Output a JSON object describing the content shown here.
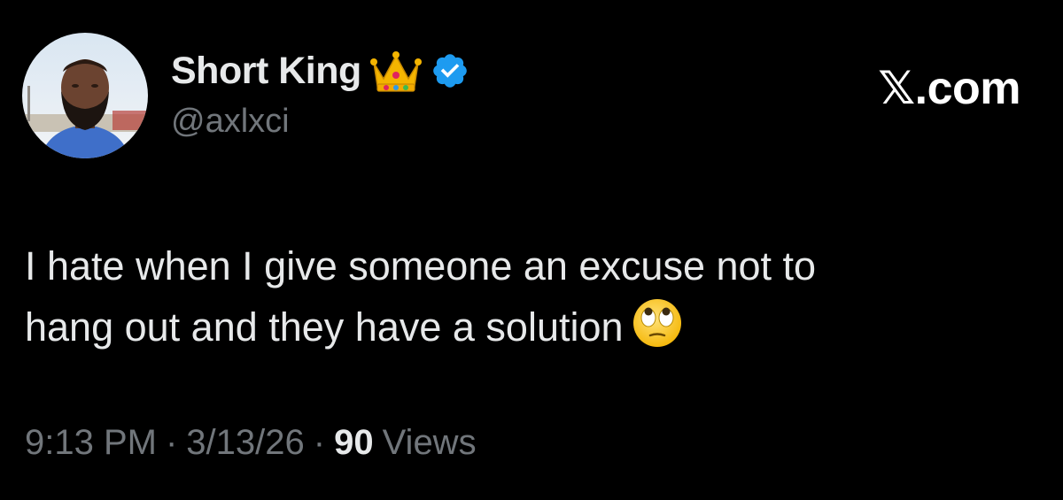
{
  "author": {
    "name": "Short King",
    "handle": "@axlxci",
    "badges": [
      "crown-emoji",
      "verified-badge"
    ],
    "verified_color": "#1d9bf0"
  },
  "site": {
    "label": "𝕏.com"
  },
  "tweet": {
    "line1": "I hate when I give someone an excuse not to",
    "line2": "hang out and they have a solution",
    "emoji": "face-with-rolling-eyes"
  },
  "meta": {
    "time": "9:13 PM",
    "separator": "·",
    "date": "3/13/26",
    "views_count": "90",
    "views_label": "Views"
  },
  "colors": {
    "background": "#000000",
    "text_primary": "#e7e9ea",
    "text_secondary": "#71767b"
  }
}
